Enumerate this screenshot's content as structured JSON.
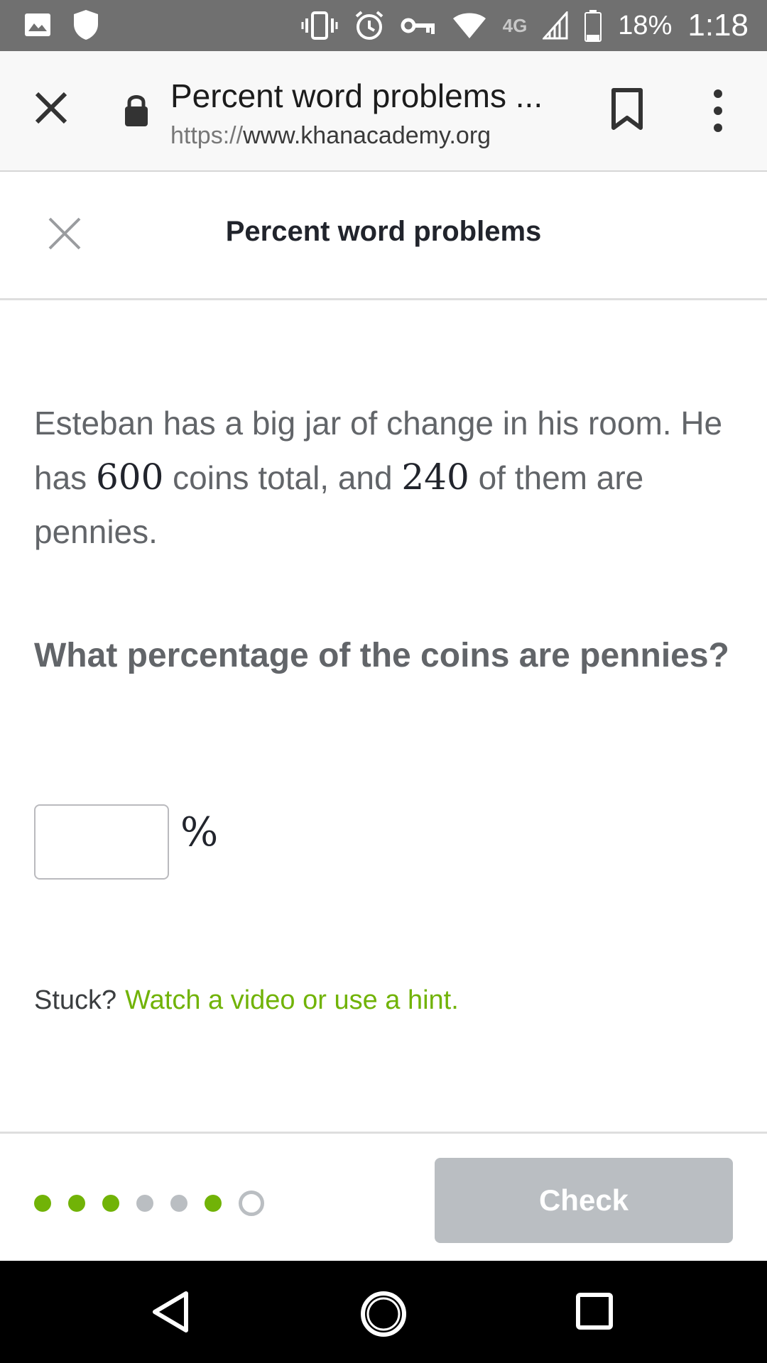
{
  "status_bar": {
    "network": "4G",
    "battery_percent": "18%",
    "time": "1:18",
    "left_icons": [
      "image-icon",
      "shield-icon"
    ],
    "right_icons": [
      "vibrate-icon",
      "alarm-icon",
      "key-icon",
      "wifi-icon",
      "signal-icon",
      "battery-icon"
    ]
  },
  "browser": {
    "page_title": "Percent word problems ...",
    "url_scheme": "https://",
    "url_host": "www.khanacademy.org"
  },
  "header": {
    "title": "Percent word problems"
  },
  "problem": {
    "text_1": "Esteban has a big jar of change in his room. He has ",
    "coins_total": "600",
    "text_2": " coins total, and ",
    "pennies": "240",
    "text_3": " of them are pennies.",
    "question": "What percentage of the coins are pennies?",
    "answer_value": "",
    "unit": "%"
  },
  "help": {
    "stuck_label": "Stuck?",
    "hint_link": "Watch a video or use a hint."
  },
  "footer": {
    "progress": [
      "correct",
      "correct",
      "correct",
      "incomplete",
      "incomplete",
      "correct",
      "current"
    ],
    "check_label": "Check"
  },
  "colors": {
    "accent_green": "#71b307",
    "disabled_gray": "#babec2",
    "status_bar": "#707070"
  }
}
